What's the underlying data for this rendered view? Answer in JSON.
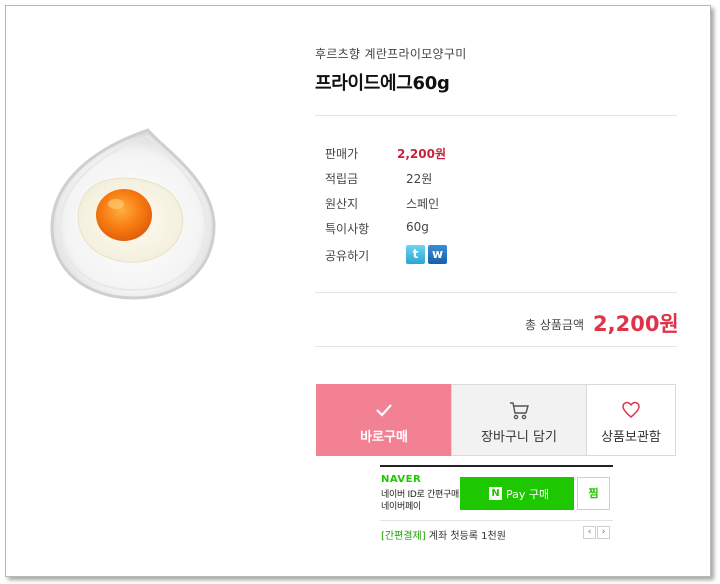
{
  "product": {
    "subtitle": "후르츠향 계란프라이모양구미",
    "title": "프라이드에그60g",
    "image_alt": "fried-egg-gummy"
  },
  "specs": [
    {
      "label": "판매가",
      "value": "2,200원"
    },
    {
      "label": "적립금",
      "value": "22원"
    },
    {
      "label": "원산지",
      "value": "스페인"
    },
    {
      "label": "특이사항",
      "value": "60g"
    },
    {
      "label": "공유하기",
      "value": ""
    }
  ],
  "share": {
    "twitter": "t",
    "weibo": "w"
  },
  "total": {
    "label": "총 상품금액",
    "value": "2,200원"
  },
  "actions": {
    "buy_now": "바로구매",
    "add_to_cart": "장바구니 담기",
    "wishlist": "상품보관함"
  },
  "naver_pay": {
    "brand": "NAVER",
    "desc_line1": "네이버 ID로 간편구매",
    "desc_line2": "네이버페이",
    "n_mark": "N",
    "pay_label": "Pay 구매",
    "zzim_label": "찜",
    "promo_tag": "[간편결제]",
    "promo_text": "계좌 첫등록 1천원",
    "prev": "‹",
    "next": "›"
  },
  "colors": {
    "accent_price": "#e0334a",
    "buy_button": "#f28193",
    "naver_green": "#1ec800"
  }
}
